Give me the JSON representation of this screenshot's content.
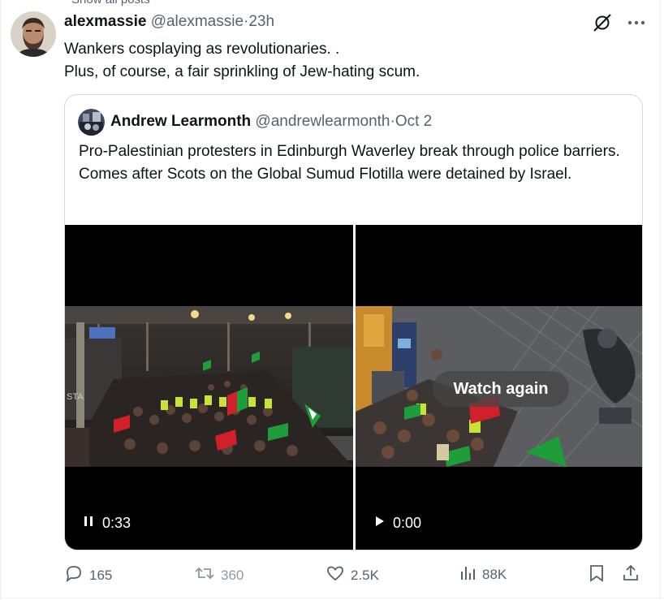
{
  "previous": {
    "text": "Show all posts"
  },
  "tweet": {
    "author_name": "alexmassie",
    "handle": "@alexmassie",
    "separator": "·",
    "time": "23h",
    "line1": "Wankers cosplaying as revolutionaries. .",
    "line2": "Plus, of course, a fair sprinkling of Jew-hating scum."
  },
  "quote": {
    "author_name": "Andrew Learmonth",
    "handle": "@andrewlearmonth",
    "separator": "·",
    "date": "Oct 2",
    "text": "Pro-Palestinian protesters in Edinburgh Waverley break through police barriers. Comes after Scots on the Global Sumud Flotilla were detained by Israel.",
    "video1": {
      "time": "0:33",
      "state_icon": "pause-icon"
    },
    "video2": {
      "time": "0:00",
      "state_icon": "play-icon",
      "overlay": "Watch again"
    }
  },
  "actions": {
    "replies": "165",
    "reposts": "360",
    "likes": "2.5K",
    "views": "88K"
  },
  "colors": {
    "text": "#0f1419",
    "muted": "#536471",
    "border": "#cfd9de",
    "flag_green": "#1f9d3a",
    "flag_red": "#d0202a"
  }
}
